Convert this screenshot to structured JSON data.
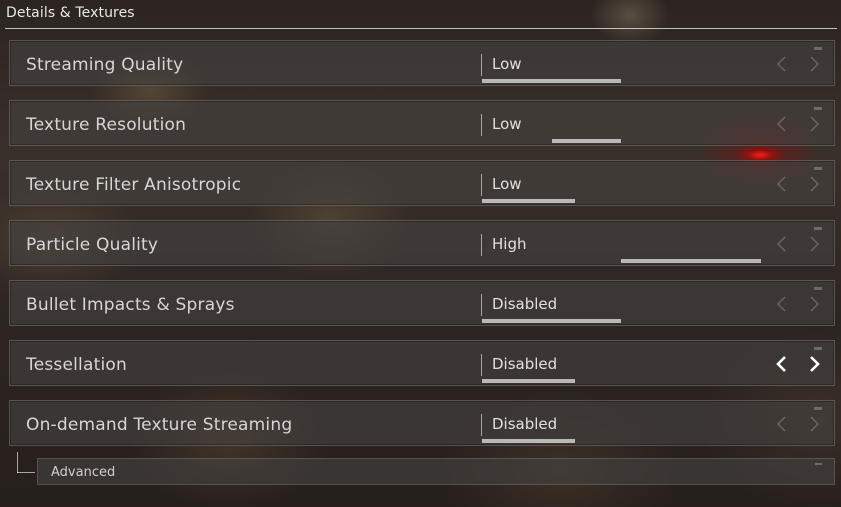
{
  "section": {
    "title": "Details & Textures"
  },
  "settings": [
    {
      "label": "Streaming Quality",
      "value": "Low"
    },
    {
      "label": "Texture Resolution",
      "value": "Low"
    },
    {
      "label": "Texture Filter Anisotropic",
      "value": "Low"
    },
    {
      "label": "Particle Quality",
      "value": "High"
    },
    {
      "label": "Bullet Impacts & Sprays",
      "value": "Disabled"
    },
    {
      "label": "Tessellation",
      "value": "Disabled"
    },
    {
      "label": "On-demand Texture Streaming",
      "value": "Disabled"
    }
  ],
  "advanced": {
    "label": "Advanced"
  },
  "icons": {
    "prev": "chevron-left-icon",
    "next": "chevron-right-icon"
  },
  "colors": {
    "active_arrow": "#ffffff",
    "inactive_arrow": "rgba(255,255,255,0.22)",
    "accent_light": "#ff2a1e"
  }
}
